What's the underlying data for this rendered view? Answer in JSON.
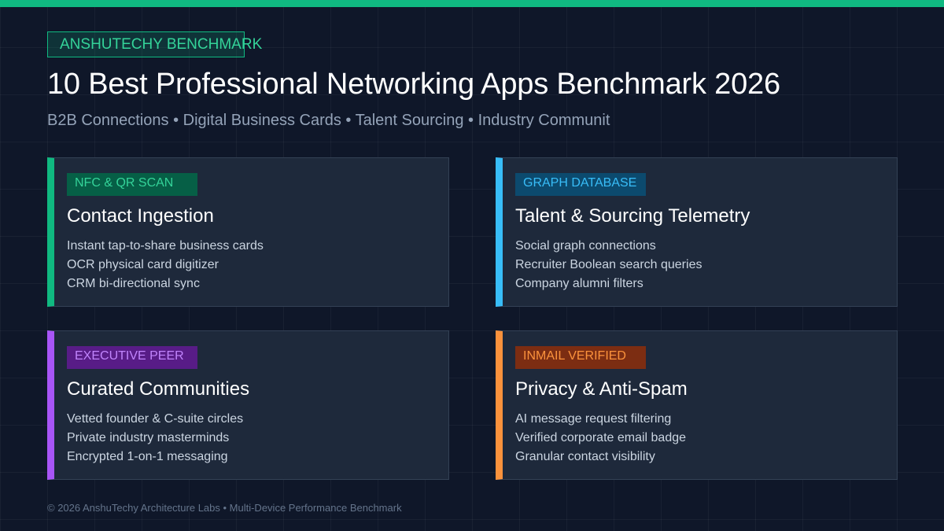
{
  "brand_tag": "ANSHUTECHY BENCHMARK",
  "title": "10 Best Professional Networking Apps Benchmark 2026",
  "subtitle": "B2B Connections • Digital Business Cards • Talent Sourcing • Industry Communit",
  "colors": {
    "background": "#0f1729",
    "accent": "#10b981",
    "card": "#1e293b"
  },
  "cards": [
    {
      "badge": "NFC & QR SCAN",
      "title": "Contact Ingestion",
      "items": [
        "Instant tap-to-share business cards",
        "OCR physical card digitizer",
        "CRM bi-directional sync"
      ],
      "accent": "#10b981",
      "badge_bg": "#065f46",
      "badge_text": "#34d399"
    },
    {
      "badge": "GRAPH DATABASE",
      "title": "Talent & Sourcing Telemetry",
      "items": [
        "Social graph connections",
        "Recruiter Boolean search queries",
        "Company alumni filters"
      ],
      "accent": "#38bdf8",
      "badge_bg": "#0c4a6e",
      "badge_text": "#38bdf8"
    },
    {
      "badge": "EXECUTIVE PEER",
      "title": "Curated Communities",
      "items": [
        "Vetted founder & C-suite circles",
        "Private industry masterminds",
        "Encrypted 1-on-1 messaging"
      ],
      "accent": "#a855f7",
      "badge_bg": "#581c87",
      "badge_text": "#c084fc"
    },
    {
      "badge": "INMAIL VERIFIED",
      "title": "Privacy & Anti-Spam",
      "items": [
        "AI message request filtering",
        "Verified corporate email badge",
        "Granular contact visibility"
      ],
      "accent": "#fb923c",
      "badge_bg": "#7c2d12",
      "badge_text": "#fb923c"
    }
  ],
  "footer": "© 2026 AnshuTechy Architecture Labs • Multi-Device Performance Benchmark"
}
